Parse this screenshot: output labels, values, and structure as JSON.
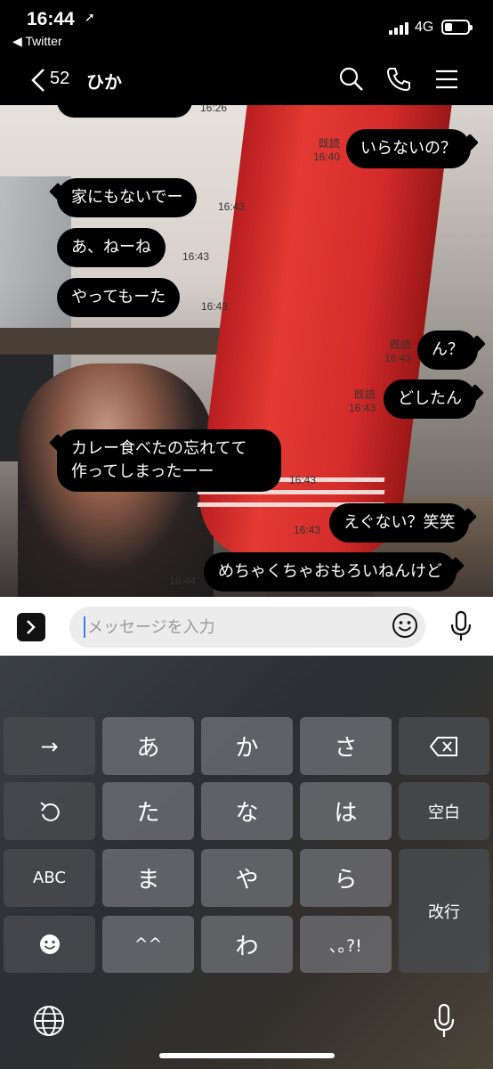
{
  "status_bar": {
    "time": "16:44",
    "back_app": "◀ Twitter",
    "network": "4G"
  },
  "header": {
    "unread_count": "52",
    "contact_name": "ひか"
  },
  "messages": [
    {
      "dir": "in",
      "text": "家にもないでー",
      "time": "16:43"
    },
    {
      "dir": "in",
      "text": "あ、ねーね",
      "time": "16:43"
    },
    {
      "dir": "in",
      "text": "やってもーた",
      "time": "16:43"
    },
    {
      "dir": "out",
      "text": "いらないの？",
      "read": "既読",
      "time": "16:40"
    },
    {
      "dir": "out",
      "text": "ん？",
      "read": "既読",
      "time": "16:43"
    },
    {
      "dir": "out",
      "text": "どしたん",
      "read": "既読",
      "time": "16:43"
    },
    {
      "dir": "in",
      "text": "カレー食べたの忘れてて\n作ってしまったーー",
      "time": "16:43"
    },
    {
      "dir": "out",
      "text": "えぐない？笑笑",
      "time": "16:43"
    },
    {
      "dir": "out",
      "text": "めちゃくちゃおもろいねんけど",
      "time": "16:44"
    }
  ],
  "partial_time_top": "16:26",
  "input": {
    "placeholder": "メッセージを入力"
  },
  "keyboard": {
    "row1": [
      "→",
      "あ",
      "か",
      "さ"
    ],
    "row2": [
      "た",
      "な",
      "は",
      "空白"
    ],
    "row3": [
      "ABC",
      "ま",
      "や",
      "ら",
      "改行"
    ],
    "row4": [
      "^^",
      "わ",
      "､｡?!"
    ]
  },
  "colors": {
    "bubble": "#000000",
    "accent_caret": "#3b7cf6",
    "header_bg": "#000000"
  }
}
